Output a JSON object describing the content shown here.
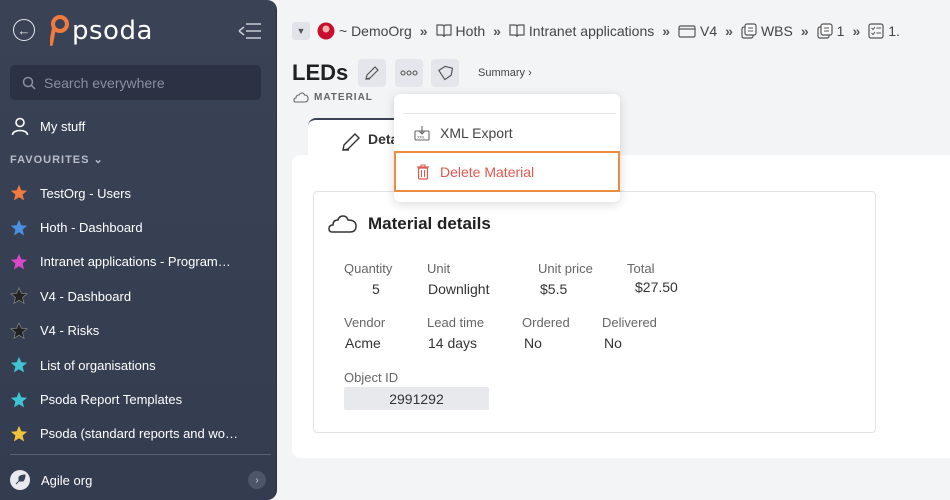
{
  "sidebar": {
    "logo_text": "psoda",
    "search_placeholder": "Search everywhere",
    "my_stuff_label": "My stuff",
    "favourites_heading": "FAVOURITES",
    "favourites": [
      {
        "label": "TestOrg - Users",
        "color": "#f07b3f"
      },
      {
        "label": "Hoth - Dashboard",
        "color": "#4a90e2"
      },
      {
        "label": "Intranet applications - Programme…",
        "color": "#d946c8"
      },
      {
        "label": "V4 - Dashboard",
        "color": "#2a2a2a"
      },
      {
        "label": "V4 - Risks",
        "color": "#2a2a2a"
      },
      {
        "label": "List of organisations",
        "color": "#3fc4d6"
      },
      {
        "label": "Psoda Report Templates",
        "color": "#3fc4d6"
      },
      {
        "label": "Psoda (standard reports and work…",
        "color": "#f0c33c"
      }
    ],
    "org_label": "Agile org"
  },
  "breadcrumb": {
    "items": [
      {
        "label": "~ DemoOrg",
        "icon": "org-avatar-icon"
      },
      {
        "label": "Hoth",
        "icon": "book-icon"
      },
      {
        "label": "Intranet applications",
        "icon": "book-icon"
      },
      {
        "label": "V4",
        "icon": "window-icon"
      },
      {
        "label": "WBS",
        "icon": "layers-icon"
      },
      {
        "label": "1",
        "icon": "layers-icon"
      },
      {
        "label": "1.",
        "icon": "checklist-icon"
      }
    ]
  },
  "header": {
    "title": "LEDs",
    "summary_label": "Summary ›",
    "subtitle": "MATERIAL"
  },
  "tab": {
    "label": "Deta"
  },
  "dropdown": {
    "xml_export_label": "XML Export",
    "delete_label": "Delete Material"
  },
  "card": {
    "title": "Material details",
    "fields": {
      "quantity_label": "Quantity",
      "quantity_value": "5",
      "unit_label": "Unit",
      "unit_value": "Downlight",
      "unit_price_label": "Unit price",
      "unit_price_value": "$5.5",
      "total_label": "Total",
      "total_value": "$27.50",
      "vendor_label": "Vendor",
      "vendor_value": "Acme",
      "lead_time_label": "Lead time",
      "lead_time_value": "14 days",
      "ordered_label": "Ordered",
      "ordered_value": "No",
      "delivered_label": "Delivered",
      "delivered_value": "No",
      "object_id_label": "Object ID",
      "object_id_value": "2991292"
    }
  }
}
